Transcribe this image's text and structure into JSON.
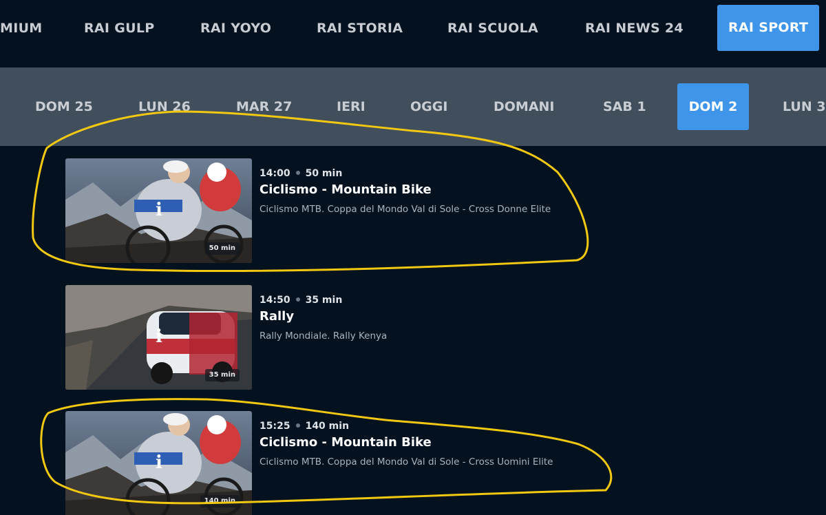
{
  "channels": [
    {
      "label": "MIUM",
      "active": false
    },
    {
      "label": "RAI GULP",
      "active": false
    },
    {
      "label": "RAI YOYO",
      "active": false
    },
    {
      "label": "RAI STORIA",
      "active": false
    },
    {
      "label": "RAI SCUOLA",
      "active": false
    },
    {
      "label": "RAI NEWS 24",
      "active": false
    },
    {
      "label": "RAI SPORT",
      "active": true
    }
  ],
  "days": [
    {
      "label": "DOM 25",
      "active": false
    },
    {
      "label": "LUN 26",
      "active": false
    },
    {
      "label": "MAR 27",
      "active": false
    },
    {
      "label": "IERI",
      "active": false
    },
    {
      "label": "OGGI",
      "active": false
    },
    {
      "label": "DOMANI",
      "active": false
    },
    {
      "label": "SAB 1",
      "active": false
    },
    {
      "label": "DOM 2",
      "active": true
    },
    {
      "label": "LUN 3",
      "active": false
    }
  ],
  "programs": [
    {
      "time": "14:00",
      "duration": "50 min",
      "title": "Ciclismo - Mountain Bike",
      "description": "Ciclismo MTB. Coppa del Mondo Val di Sole - Cross Donne Elite",
      "badge": "50 min",
      "thumbnail": "mountain-bike-thumbnail"
    },
    {
      "time": "14:50",
      "duration": "35 min",
      "title": "Rally",
      "description": "Rally Mondiale. Rally Kenya",
      "badge": "35 min",
      "thumbnail": "rally-car-thumbnail"
    },
    {
      "time": "15:25",
      "duration": "140 min",
      "title": "Ciclismo - Mountain Bike",
      "description": "Ciclismo MTB. Coppa del Mondo Val di Sole - Cross Uomini Elite",
      "badge": "140 min",
      "thumbnail": "mountain-bike-thumbnail"
    }
  ],
  "info_icon": "i",
  "colors": {
    "accent": "#3f95ea",
    "background": "#041220",
    "day_bar": "#414e5c",
    "annotation": "#f2c811"
  }
}
